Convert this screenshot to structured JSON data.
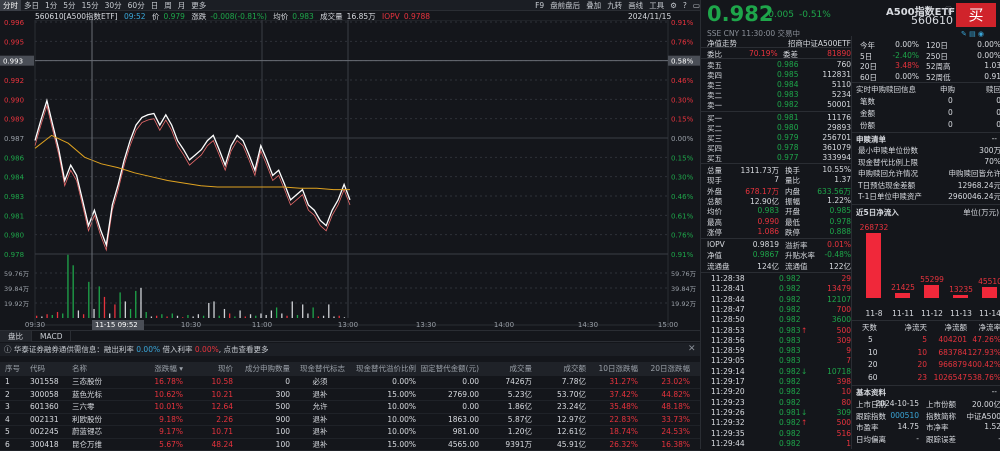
{
  "topbar": {
    "tabs": [
      "分时",
      "多日",
      "1分",
      "5分",
      "15分",
      "30分",
      "60分",
      "日",
      "周",
      "月",
      "更多"
    ],
    "tools": [
      "F9",
      "盘前盘后",
      "叠加",
      "九转",
      "画线",
      "工具"
    ]
  },
  "info": {
    "code_name": "560610[A500指数ETF]",
    "time": "09:52",
    "price_label": "价",
    "price": "0.979",
    "chg_label": "涨跌",
    "chg": "-0.008(-0.81%)",
    "avg_label": "均价",
    "avg": "0.983",
    "vol_label": "成交量",
    "vol": "16.85万",
    "iopv_label": "IOPV",
    "iopv": "0.9788",
    "date": "2024/11/15"
  },
  "chart_data": {
    "type": "line",
    "title": "分时",
    "prev_close": 0.987,
    "ylim": [
      0.978,
      0.996
    ],
    "y_ticks": [
      "0.996",
      "0.995",
      "0.993",
      "0.992",
      "0.990",
      "0.989",
      "0.987",
      "0.986",
      "0.984",
      "0.983",
      "0.981",
      "0.980",
      "0.978"
    ],
    "pct_ticks": [
      "0.91%",
      "0.76%",
      "0.61%",
      "0.46%",
      "0.30%",
      "0.15%",
      "0.00%",
      "0.15%",
      "0.30%",
      "0.46%",
      "0.61%",
      "0.76%",
      "0.91%"
    ],
    "vol_ticks": [
      "59.76万",
      "39.84万",
      "19.92万"
    ],
    "x_ticks": [
      "09:30",
      "10:30",
      "11:00",
      "13:00",
      "13:30",
      "14:00",
      "14:30",
      "15:00"
    ],
    "cursor": {
      "price": "0.993",
      "pct": "0.58%",
      "time": "11-15 09:52"
    },
    "price": [
      0.9868,
      0.9884,
      0.9899,
      0.988,
      0.9861,
      0.9837,
      0.9849,
      0.9841,
      0.9822,
      0.9802,
      0.9814,
      0.9799,
      0.9787,
      0.9818,
      0.9834,
      0.9853,
      0.9868,
      0.988,
      0.9886,
      0.9888,
      0.9889,
      0.988,
      0.9888,
      0.988,
      0.9868,
      0.9861,
      0.9853,
      0.9857,
      0.9861,
      0.9868,
      0.9872,
      0.9861,
      0.9849,
      0.9864,
      0.9872,
      0.9868,
      0.9857,
      0.9845,
      0.9864,
      0.9853,
      0.9841,
      0.9845,
      0.9834,
      0.9822,
      0.9826,
      0.983,
      0.9818,
      0.9814,
      0.9806,
      0.9802,
      0.9814,
      0.9822,
      0.9834,
      0.9822
    ],
    "avg": [
      0.9862,
      0.9872,
      0.9866,
      0.9855,
      0.985,
      0.9847,
      0.9843,
      0.984,
      0.9837,
      0.9835,
      0.9833,
      0.9832,
      0.9832,
      0.9832,
      0.9832,
      0.9832,
      0.9831,
      0.9831,
      0.983,
      0.983
    ],
    "volume": [
      3,
      2,
      5,
      4,
      8,
      6,
      84,
      70,
      10,
      5,
      48,
      12,
      42,
      28,
      6,
      18,
      34,
      22,
      12,
      36,
      40,
      8,
      2,
      3,
      5,
      2,
      6,
      3,
      1,
      4,
      2,
      5,
      3,
      20,
      22,
      3,
      12,
      6,
      2,
      10,
      2,
      5,
      3,
      6,
      4,
      10,
      14,
      6,
      3,
      22,
      4,
      18,
      6,
      14,
      2,
      3,
      18,
      2,
      3,
      1
    ],
    "volume_colors": [
      "r",
      "w",
      "r",
      "g",
      "r",
      "g",
      "g",
      "g",
      "w",
      "r",
      "g",
      "w",
      "g",
      "r",
      "w",
      "r",
      "g",
      "w",
      "g",
      "g",
      "w",
      "g",
      "w",
      "r",
      "g",
      "r",
      "g",
      "w",
      "r",
      "g",
      "w",
      "w",
      "g",
      "w",
      "w",
      "g",
      "w",
      "r",
      "g",
      "w",
      "r",
      "w",
      "g",
      "w",
      "w",
      "w",
      "g",
      "w",
      "r",
      "w",
      "g",
      "w",
      "w",
      "g",
      "r",
      "w",
      "w",
      "w",
      "r",
      "w"
    ]
  },
  "lower_tabs": [
    "盘比",
    "MACD"
  ],
  "notice": {
    "text": "华泰证券融券通供需信息：融出利率",
    "rate1": "0.00%",
    "mid": "借入利率",
    "rate2": "0.00%",
    "tail": "点击查看更多"
  },
  "table": {
    "headers": [
      "序号",
      "代码",
      "名称",
      "涨跌幅 ▾",
      "现价",
      "成分申购数量",
      "现金替代标志",
      "现金替代溢价比例",
      "固定替代金额(元)",
      "成交量",
      "成交额",
      "10日涨跌幅",
      "20日涨跌幅"
    ],
    "rows": [
      [
        "1",
        "301558",
        "三态股份",
        "16.78%",
        "10.58",
        "0",
        "必须",
        "0.00%",
        "0.00",
        "7426万",
        "7.78亿",
        "31.27%",
        "23.02%"
      ],
      [
        "2",
        "300058",
        "蓝色光标",
        "10.62%",
        "10.21",
        "300",
        "退补",
        "15.00%",
        "2769.00",
        "5.23亿",
        "53.70亿",
        "37.42%",
        "44.82%"
      ],
      [
        "3",
        "601360",
        "三六零",
        "10.01%",
        "12.64",
        "500",
        "允许",
        "10.00%",
        "0.00",
        "1.86亿",
        "23.24亿",
        "35.48%",
        "48.18%"
      ],
      [
        "4",
        "002131",
        "利欧股份",
        "9.18%",
        "2.26",
        "900",
        "退补",
        "10.00%",
        "1863.00",
        "5.87亿",
        "12.97亿",
        "22.83%",
        "33.73%"
      ],
      [
        "5",
        "002245",
        "蔚蓝锂芯",
        "9.17%",
        "10.71",
        "100",
        "退补",
        "10.00%",
        "981.00",
        "1.20亿",
        "12.61亿",
        "18.74%",
        "24.53%"
      ],
      [
        "6",
        "300418",
        "昆仑万维",
        "5.67%",
        "48.24",
        "100",
        "退补",
        "15.00%",
        "4565.00",
        "9391万",
        "45.91亿",
        "26.32%",
        "16.38%"
      ]
    ]
  },
  "quote": {
    "name": "A500指数ETF",
    "code": "560610",
    "buy": "买",
    "price": "0.982",
    "chg": "-0.005",
    "pct": "-0.51%",
    "status": "SSE  CNY  11:30:00  交易中",
    "nav_label": "净值走势",
    "fund_name": "招商中证A500ETF",
    "ratio_label": "委比",
    "ratio": "70.19%",
    "diff_label": "委差",
    "diff": "81890",
    "asks": [
      [
        "卖五",
        "0.986",
        "760"
      ],
      [
        "卖四",
        "0.985",
        "112831"
      ],
      [
        "卖三",
        "0.984",
        "5110"
      ],
      [
        "卖二",
        "0.983",
        "5234"
      ],
      [
        "卖一",
        "0.982",
        "50001"
      ]
    ],
    "bids": [
      [
        "买一",
        "0.981",
        "11176"
      ],
      [
        "买二",
        "0.980",
        "29893"
      ],
      [
        "买三",
        "0.979",
        "256701"
      ],
      [
        "买四",
        "0.978",
        "361079"
      ],
      [
        "买五",
        "0.977",
        "333994"
      ]
    ],
    "stats": [
      [
        "总量",
        "1311.73万",
        "w",
        "换手",
        "10.55%",
        "w"
      ],
      [
        "现手",
        "7",
        "w",
        "量比",
        "1.37",
        "w"
      ],
      [
        "外盘",
        "678.17万",
        "r",
        "内盘",
        "633.56万",
        "g"
      ],
      [
        "总额",
        "12.90亿",
        "w",
        "振幅",
        "1.22%",
        "w"
      ],
      [
        "均价",
        "0.983",
        "g",
        "开盘",
        "0.985",
        "g"
      ],
      [
        "最高",
        "0.990",
        "r",
        "最低",
        "0.978",
        "g"
      ],
      [
        "涨停",
        "1.086",
        "r",
        "跌停",
        "0.888",
        "g"
      ],
      [
        "IOPV",
        "0.9819",
        "w",
        "溢折率",
        "0.01%",
        "r"
      ],
      [
        "净值",
        "0.9867",
        "g",
        "升贴水率",
        "-0.48%",
        "g"
      ],
      [
        "流通盘",
        "124亿",
        "w",
        "流通值",
        "122亿",
        "w"
      ]
    ],
    "trades": [
      [
        "11:28:38",
        "0.982",
        "",
        "29",
        "r"
      ],
      [
        "11:28:41",
        "0.982",
        "",
        "13479",
        "r"
      ],
      [
        "11:28:44",
        "0.982",
        "",
        "12107",
        "g"
      ],
      [
        "11:28:47",
        "0.982",
        "",
        "700",
        "r"
      ],
      [
        "11:28:50",
        "0.982",
        "",
        "3600",
        "g"
      ],
      [
        "11:28:53",
        "0.983",
        "↑",
        "500",
        "r"
      ],
      [
        "11:28:56",
        "0.983",
        "",
        "309",
        "r"
      ],
      [
        "11:28:59",
        "0.983",
        "",
        "9",
        "r"
      ],
      [
        "11:29:05",
        "0.983",
        "",
        "7",
        "r"
      ],
      [
        "11:29:14",
        "0.982",
        "↓",
        "10718",
        "g"
      ],
      [
        "11:29:17",
        "0.982",
        "",
        "398",
        "r"
      ],
      [
        "11:29:20",
        "0.982",
        "",
        "10",
        "r"
      ],
      [
        "11:29:23",
        "0.982",
        "",
        "80",
        "r"
      ],
      [
        "11:29:26",
        "0.981",
        "↓",
        "309",
        "g"
      ],
      [
        "11:29:32",
        "0.982",
        "↑",
        "500",
        "r"
      ],
      [
        "11:29:35",
        "0.982",
        "",
        "516",
        "r"
      ],
      [
        "11:29:44",
        "0.982",
        "",
        "1",
        "r"
      ]
    ]
  },
  "perf": [
    [
      "今年",
      "0.00%",
      "w",
      "120日",
      "0.00%"
    ],
    [
      "5日",
      "-2.40%",
      "g",
      "250日",
      "0.00%"
    ],
    [
      "20日",
      "3.48%",
      "r",
      "52周高",
      "1.03"
    ],
    [
      "60日",
      "0.00%",
      "w",
      "52周低",
      "0.91"
    ]
  ],
  "creation": {
    "title": "实时申购赎回信息",
    "col1": "申购",
    "col2": "赎回",
    "rows": [
      [
        "笔数",
        "0",
        "0"
      ],
      [
        "金额",
        "0",
        "0"
      ],
      [
        "份额",
        "0",
        "0"
      ]
    ]
  },
  "basket": {
    "title": "申赎清单",
    "dash": "--",
    "rows": [
      [
        "最小申赎单位份数",
        "300万"
      ],
      [
        "现金替代比例上限",
        "70%"
      ],
      [
        "申购赎回允许情况",
        "申购赎回皆允许"
      ],
      [
        "T日预估现金差额",
        "12968.24元"
      ],
      [
        "T-1日单位申赎资产",
        "2960046.24元"
      ]
    ]
  },
  "inflow": {
    "title": "近5日净流入",
    "unit": "单位(万元)",
    "dates": [
      "11-8",
      "11-11",
      "11-12",
      "11-13",
      "11-14"
    ],
    "values": [
      268732,
      21425,
      55299,
      13235,
      45510
    ]
  },
  "flow_table": {
    "headers": [
      "天数",
      "净流天",
      "净流额",
      "净流率"
    ],
    "rows": [
      [
        "5",
        "5",
        "404201",
        "47.26%"
      ],
      [
        "10",
        "10",
        "683784",
        "127.93%"
      ],
      [
        "20",
        "20",
        "966879",
        "400.42%"
      ],
      [
        "60",
        "23",
        "1026547",
        "538.76%"
      ]
    ]
  },
  "basic": {
    "title": "基本资料",
    "dash": "--",
    "rows": [
      [
        "上市日期",
        "2024-10-15",
        "上市份额",
        "20.00亿"
      ],
      [
        "跟踪指数",
        "000510",
        "指数简称",
        "中证A500"
      ],
      [
        "市盈率",
        "14.75",
        "市净率",
        "1.52"
      ],
      [
        "日均偏离",
        "-",
        "跟踪误差",
        "-"
      ]
    ]
  },
  "colors": {
    "up": "#e8333d",
    "down": "#1ea64a",
    "bg": "#14161b",
    "avg": "#e0a320"
  }
}
